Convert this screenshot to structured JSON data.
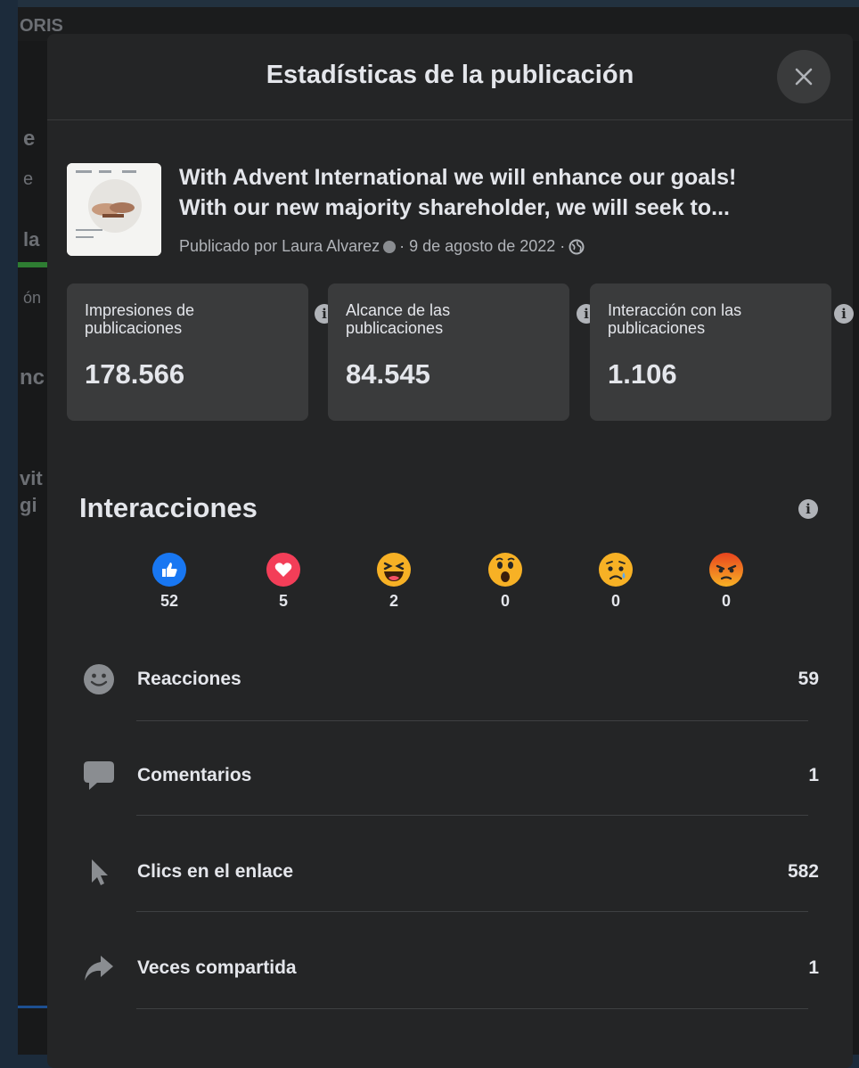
{
  "background": {
    "fragment_top": "ORIS",
    "fragments": [
      "e",
      "e",
      "la",
      "ón",
      "nc",
      "vit",
      "gi"
    ]
  },
  "modal": {
    "title": "Estadísticas de la publicación",
    "close_icon": "close-icon"
  },
  "post": {
    "text_line1": "With Advent International we will enhance our goals!",
    "text_line2": "With our new majority shareholder, we will seek to...",
    "meta_prefix": "Publicado por Laura Alvarez",
    "meta_date": "· 9 de agosto de 2022 ·"
  },
  "stats": [
    {
      "label": "Impresiones de publicaciones",
      "value": "178.566"
    },
    {
      "label": "Alcance de las publicaciones",
      "value": "84.545"
    },
    {
      "label": "Interacción con las publicaciones",
      "value": "1.106"
    }
  ],
  "interactions": {
    "title": "Interacciones",
    "reactions": [
      {
        "icon": "like-icon",
        "count": "52",
        "color": "#1877f2"
      },
      {
        "icon": "love-icon",
        "count": "5",
        "color": "#f33e58"
      },
      {
        "icon": "haha-icon",
        "count": "2",
        "color": "#f7b125"
      },
      {
        "icon": "wow-icon",
        "count": "0",
        "color": "#f7b125"
      },
      {
        "icon": "sad-icon",
        "count": "0",
        "color": "#f7b125"
      },
      {
        "icon": "angry-icon",
        "count": "0",
        "color": "#e9710f"
      }
    ],
    "metrics": [
      {
        "icon": "smiley-icon",
        "label": "Reacciones",
        "value": "59"
      },
      {
        "icon": "comment-icon",
        "label": "Comentarios",
        "value": "1"
      },
      {
        "icon": "cursor-icon",
        "label": "Clics en el enlace",
        "value": "582"
      },
      {
        "icon": "share-icon",
        "label": "Veces compartida",
        "value": "1"
      }
    ]
  },
  "colors": {
    "modal_bg": "#242526",
    "card_bg": "#3a3b3c",
    "text_primary": "#e4e6eb",
    "text_secondary": "#b0b3b8"
  }
}
